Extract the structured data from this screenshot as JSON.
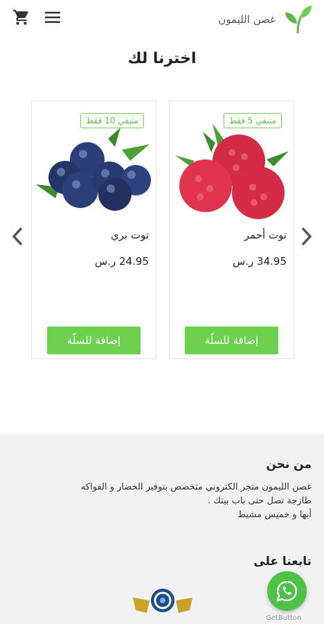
{
  "header": {
    "brand_name": "غصن الليمون",
    "cart_icon": "shopping-cart-icon",
    "menu_icon": "hamburger-menu-icon",
    "logo_icon": "leaf-logo-icon"
  },
  "section": {
    "title": "اخترنا لك"
  },
  "products": [
    {
      "name": "توت أحمر",
      "price": "34.95 ر.س",
      "stock": "متبقي 5 فقط",
      "add_label": "إضافة للسلّة",
      "image": "raspberry"
    },
    {
      "name": "توت بري",
      "price": "24.95 ر.س",
      "stock": "متبقي 10 فقط",
      "add_label": "إضافة للسلّة",
      "image": "blueberry"
    }
  ],
  "footer": {
    "about_title": "من نحن",
    "about_line1": "غصن الليمون متجر الكتروني متخصص بتوفير الخضار و الفواكه",
    "about_line2": "طازجة تصل حتى باب بيتك .",
    "about_line3": "أبها و خميس مشيط",
    "follow_title": "تابعنا على"
  },
  "widget": {
    "label": "GetButton",
    "icon": "whatsapp-icon"
  },
  "colors": {
    "accent": "#6dd04e",
    "footer_bg": "#f2f2f2",
    "badge": "#5cbf43",
    "whatsapp": "#4dc247"
  }
}
